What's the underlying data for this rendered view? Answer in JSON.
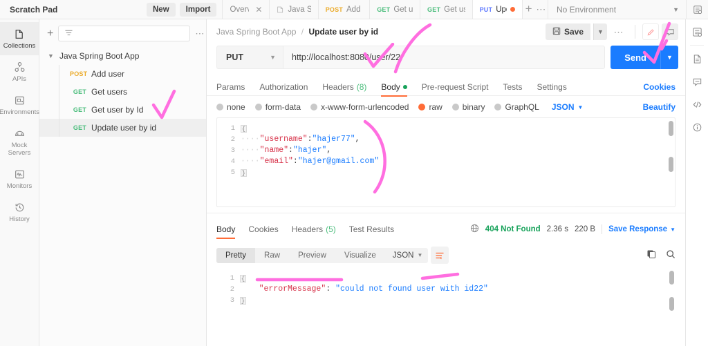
{
  "topbar": {
    "workspace": "Scratch Pad",
    "new_label": "New",
    "import_label": "Import",
    "environment": "No Environment",
    "tabs": [
      {
        "method": "",
        "label": "Overview",
        "closable": true,
        "active": false,
        "icon": ""
      },
      {
        "method": "",
        "label": "Java Sprin",
        "closable": false,
        "active": false,
        "icon": "collection-icon"
      },
      {
        "method": "POST",
        "label": "Add user",
        "closable": false,
        "active": false,
        "icon": ""
      },
      {
        "method": "GET",
        "label": "Get users",
        "closable": false,
        "active": false,
        "icon": ""
      },
      {
        "method": "GET",
        "label": "Get user b",
        "closable": false,
        "active": false,
        "icon": ""
      },
      {
        "method": "PUT",
        "label": "Update",
        "closable": false,
        "active": true,
        "unsaved": true,
        "icon": ""
      }
    ]
  },
  "rail": {
    "items": [
      {
        "label": "Collections",
        "icon": "collection-icon",
        "active": true
      },
      {
        "label": "APIs",
        "icon": "apis-icon",
        "active": false
      },
      {
        "label": "Environments",
        "icon": "environment-icon",
        "active": false
      },
      {
        "label": "Mock Servers",
        "icon": "mock-server-icon",
        "active": false
      },
      {
        "label": "Monitors",
        "icon": "monitor-icon",
        "active": false
      },
      {
        "label": "History",
        "icon": "history-icon",
        "active": false
      }
    ]
  },
  "sidebar": {
    "filter_placeholder": "",
    "collection": "Java Spring Boot App",
    "requests": [
      {
        "method": "POST",
        "name": "Add user",
        "selected": false
      },
      {
        "method": "GET",
        "name": "Get users",
        "selected": false
      },
      {
        "method": "GET",
        "name": "Get user by Id",
        "selected": false
      },
      {
        "method": "GET",
        "name": "Update user by id",
        "selected": true
      }
    ]
  },
  "breadcrumb": {
    "collection": "Java Spring Boot App",
    "separator": "/",
    "request": "Update user by id",
    "save_label": "Save"
  },
  "request": {
    "method": "PUT",
    "url": "http://localhost:8080/user/22",
    "send_label": "Send",
    "tabs": [
      {
        "label": "Params",
        "active": false
      },
      {
        "label": "Authorization",
        "active": false
      },
      {
        "label": "Headers",
        "count": "(8)",
        "active": false
      },
      {
        "label": "Body",
        "active": true,
        "dot": true
      },
      {
        "label": "Pre-request Script",
        "active": false
      },
      {
        "label": "Tests",
        "active": false
      },
      {
        "label": "Settings",
        "active": false
      }
    ],
    "cookies_label": "Cookies",
    "body_types": [
      {
        "label": "none",
        "selected": false
      },
      {
        "label": "form-data",
        "selected": false
      },
      {
        "label": "x-www-form-urlencoded",
        "selected": false
      },
      {
        "label": "raw",
        "selected": true
      },
      {
        "label": "binary",
        "selected": false
      },
      {
        "label": "GraphQL",
        "selected": false
      }
    ],
    "raw_format": "JSON",
    "beautify_label": "Beautify",
    "body_lines": [
      "1",
      "2",
      "3",
      "4",
      "5"
    ],
    "body_json": {
      "username": "hajer77",
      "name": "hajer",
      "email": "hajer@gmail.com"
    }
  },
  "response": {
    "tabs": [
      {
        "label": "Body",
        "active": true
      },
      {
        "label": "Cookies",
        "active": false
      },
      {
        "label": "Headers",
        "count": "(5)",
        "active": false
      },
      {
        "label": "Test Results",
        "active": false
      }
    ],
    "status": "404 Not Found",
    "time": "2.36 s",
    "size": "220 B",
    "save_response_label": "Save Response",
    "view_modes": [
      {
        "label": "Pretty",
        "active": true
      },
      {
        "label": "Raw",
        "active": false
      },
      {
        "label": "Preview",
        "active": false
      },
      {
        "label": "Visualize",
        "active": false
      }
    ],
    "format": "JSON",
    "body_lines": [
      "1",
      "2",
      "3"
    ],
    "body_key": "errorMessage",
    "body_value": "could not found user with id22"
  },
  "right_rail": {
    "items": [
      {
        "icon": "environment-quick-look-icon"
      },
      {
        "icon": "documentation-icon"
      },
      {
        "icon": "comment-icon"
      },
      {
        "icon": "code-icon"
      },
      {
        "icon": "info-icon"
      }
    ]
  },
  "colors": {
    "accent": "#ff6c37",
    "send_blue": "#1a7cff",
    "get_green": "#4bbd7c",
    "post_orange": "#ebab2b",
    "put_blue": "#5c77ff",
    "annotation_pink": "#ff6ee0",
    "status_green": "#17a25a"
  }
}
